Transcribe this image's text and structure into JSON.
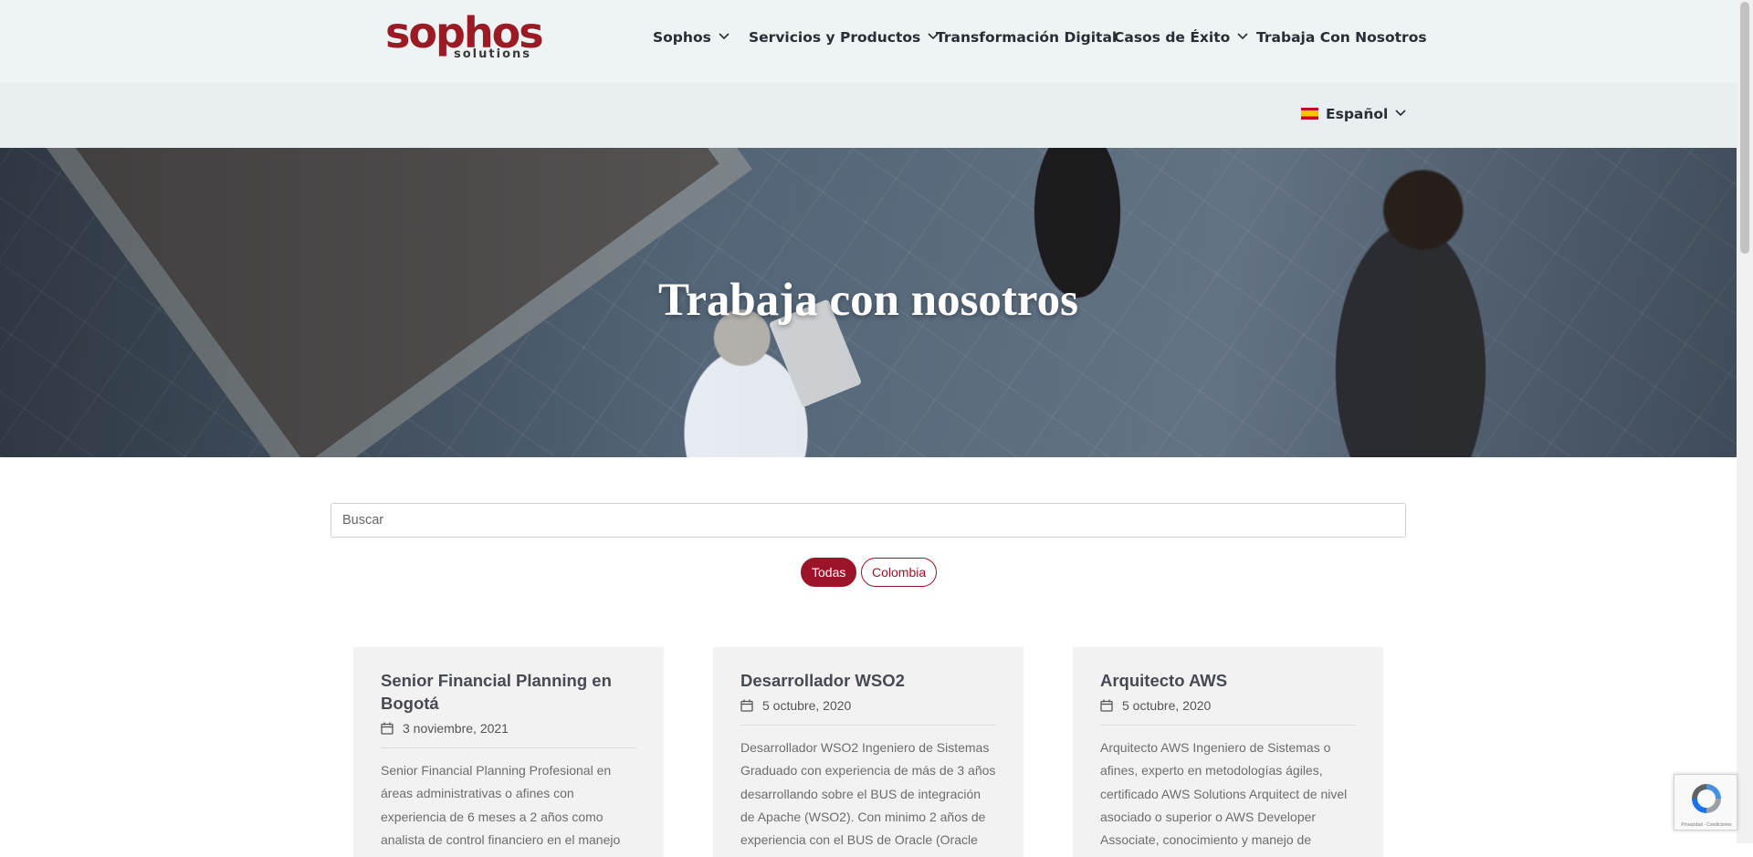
{
  "brand": {
    "logo_main": "sophos",
    "logo_sub": "solutions"
  },
  "nav": {
    "items": [
      {
        "label": "Sophos",
        "dropdown": true
      },
      {
        "label": "Servicios y Productos",
        "dropdown": true
      },
      {
        "label": "Transformación Digital",
        "dropdown": false
      },
      {
        "label": "Casos de Éxito",
        "dropdown": true
      },
      {
        "label": "Trabaja Con Nosotros",
        "dropdown": false
      }
    ]
  },
  "language": {
    "label": "Español",
    "flag": "spain-flag-icon"
  },
  "hero": {
    "title": "Trabaja con nosotros"
  },
  "search": {
    "placeholder": "Buscar",
    "value": ""
  },
  "filters": [
    {
      "label": "Todas",
      "active": true
    },
    {
      "label": "Colombia",
      "active": false
    }
  ],
  "jobs": [
    {
      "title": "Senior Financial Planning en Bogotá",
      "date": "3 noviembre, 2021",
      "excerpt": "Senior Financial Planning Profesional en áreas administrativas o afines con experiencia de 6 meses a 2 años como analista de control financiero en el manejo"
    },
    {
      "title": "Desarrollador WSO2",
      "date": "5 octubre, 2020",
      "excerpt": "Desarrollador WSO2 Ingeniero de Sistemas Graduado con experiencia de más de 3 años desarrollando sobre el BUS de integración de Apache (WSO2). Con minimo 2 años de experiencia con el BUS de Oracle (Oracle"
    },
    {
      "title": "Arquitecto AWS",
      "date": "5 octubre, 2020",
      "excerpt": "Arquitecto AWS Ingeniero de Sistemas o afines, experto en metodologías ágiles, certificado AWS Solutions Arquitect de nivel asociado o superior o AWS Developer Associate, conocimiento y manejo de"
    }
  ],
  "recaptcha": {
    "text": "Privacidad - Condiciones"
  },
  "colors": {
    "brand": "#9b1428",
    "header_bg": "#eef3f4",
    "card_bg": "#f2f2f2",
    "nav_text": "#2a2d35"
  }
}
